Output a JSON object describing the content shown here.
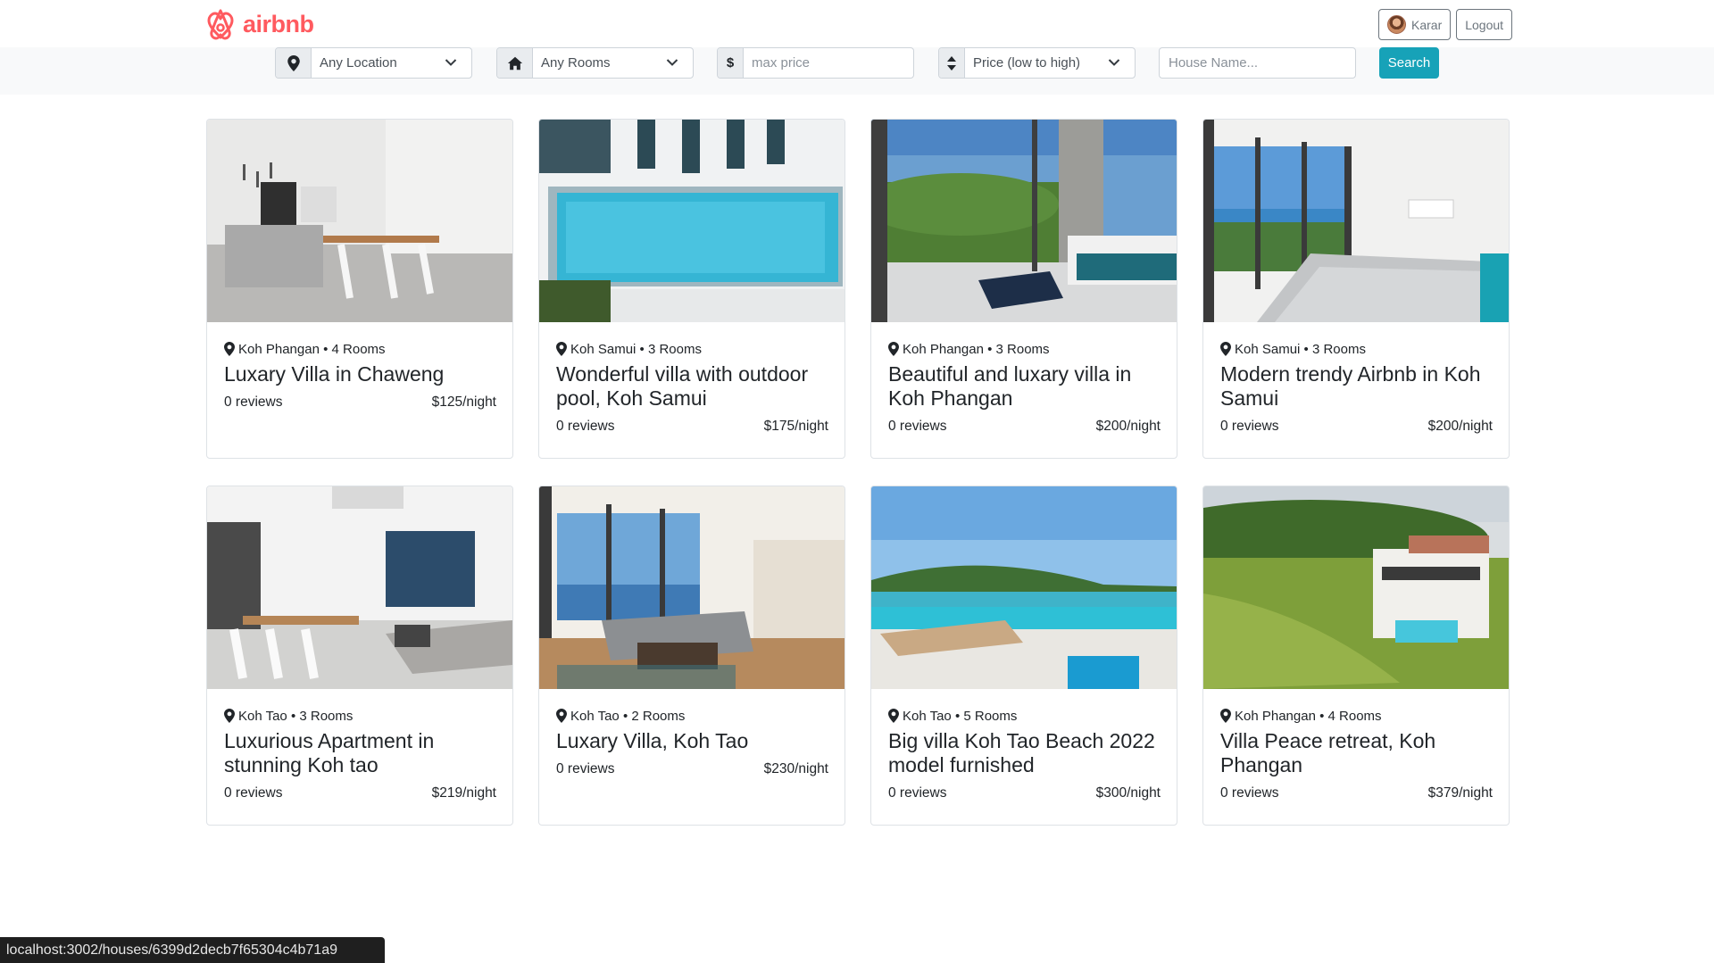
{
  "brand": {
    "name": "airbnb",
    "color": "#FF5A5F"
  },
  "nav": {
    "user_label": "Karar",
    "logout_label": "Logout"
  },
  "filters": {
    "location": "Any Location",
    "rooms": "Any Rooms",
    "price_addon": "$",
    "price_placeholder": "max price",
    "sort": "Price (low to high)",
    "house_name_placeholder": "House Name...",
    "search_label": "Search",
    "accent": "#17a2b8"
  },
  "houses": [
    {
      "location": "Koh Phangan",
      "rooms": "4 Rooms",
      "title": "Luxary Villa in Chaweng",
      "reviews": "0 reviews",
      "price": "$125/night"
    },
    {
      "location": "Koh Samui",
      "rooms": "3 Rooms",
      "title": "Wonderful villa with outdoor pool, Koh Samui",
      "reviews": "0 reviews",
      "price": "$175/night"
    },
    {
      "location": "Koh Phangan",
      "rooms": "3 Rooms",
      "title": "Beautiful and luxary villa in Koh Phangan",
      "reviews": "0 reviews",
      "price": "$200/night"
    },
    {
      "location": "Koh Samui",
      "rooms": "3 Rooms",
      "title": "Modern trendy Airbnb in Koh Samui",
      "reviews": "0 reviews",
      "price": "$200/night"
    },
    {
      "location": "Koh Tao",
      "rooms": "3 Rooms",
      "title": "Luxurious Apartment in stunning Koh tao",
      "reviews": "0 reviews",
      "price": "$219/night"
    },
    {
      "location": "Koh Tao",
      "rooms": "2 Rooms",
      "title": "Luxary Villa, Koh Tao",
      "reviews": "0 reviews",
      "price": "$230/night"
    },
    {
      "location": "Koh Tao",
      "rooms": "5 Rooms",
      "title": "Big villa Koh Tao Beach 2022 model furnished",
      "reviews": "0 reviews",
      "price": "$300/night"
    },
    {
      "location": "Koh Phangan",
      "rooms": "4 Rooms",
      "title": "Villa Peace retreat, Koh Phangan",
      "reviews": "0 reviews",
      "price": "$379/night"
    }
  ],
  "status_url": "localhost:3002/houses/6399d2decb7f65304c4b71a9"
}
